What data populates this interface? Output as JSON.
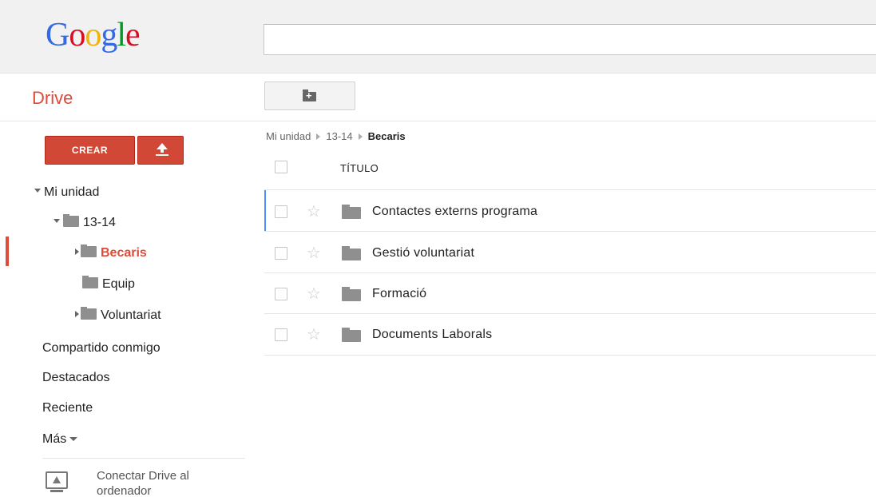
{
  "header": {
    "logo_letters": [
      "G",
      "o",
      "o",
      "g",
      "l",
      "e"
    ],
    "search_value": ""
  },
  "app": {
    "title": "Drive"
  },
  "sidebar": {
    "create_label": "CREAR",
    "tree": {
      "root": "Mi unidad",
      "folder_1314": "13-14",
      "becaris": "Becaris",
      "equip": "Equip",
      "voluntariat": "Voluntariat"
    },
    "links": {
      "shared": "Compartido conmigo",
      "starred": "Destacados",
      "recent": "Reciente",
      "more": "Más"
    },
    "connect": {
      "line1": "Conectar Drive al",
      "line2": "ordenador"
    }
  },
  "main": {
    "breadcrumb": [
      "Mi unidad",
      "13-14",
      "Becaris"
    ],
    "column_title": "TÍTULO",
    "rows": [
      {
        "name": "Contactes externs programa"
      },
      {
        "name": "Gestió voluntariat"
      },
      {
        "name": "Formació"
      },
      {
        "name": "Documents Laborals"
      }
    ]
  },
  "colors": {
    "accent_red": "#dd4b39",
    "button_red": "#d14836",
    "selection_blue": "#4d90fe"
  },
  "icons": [
    "new-folder-icon",
    "upload-icon",
    "folder-icon",
    "star-icon",
    "checkbox",
    "expand-triangle-icon",
    "computer-drive-icon"
  ]
}
